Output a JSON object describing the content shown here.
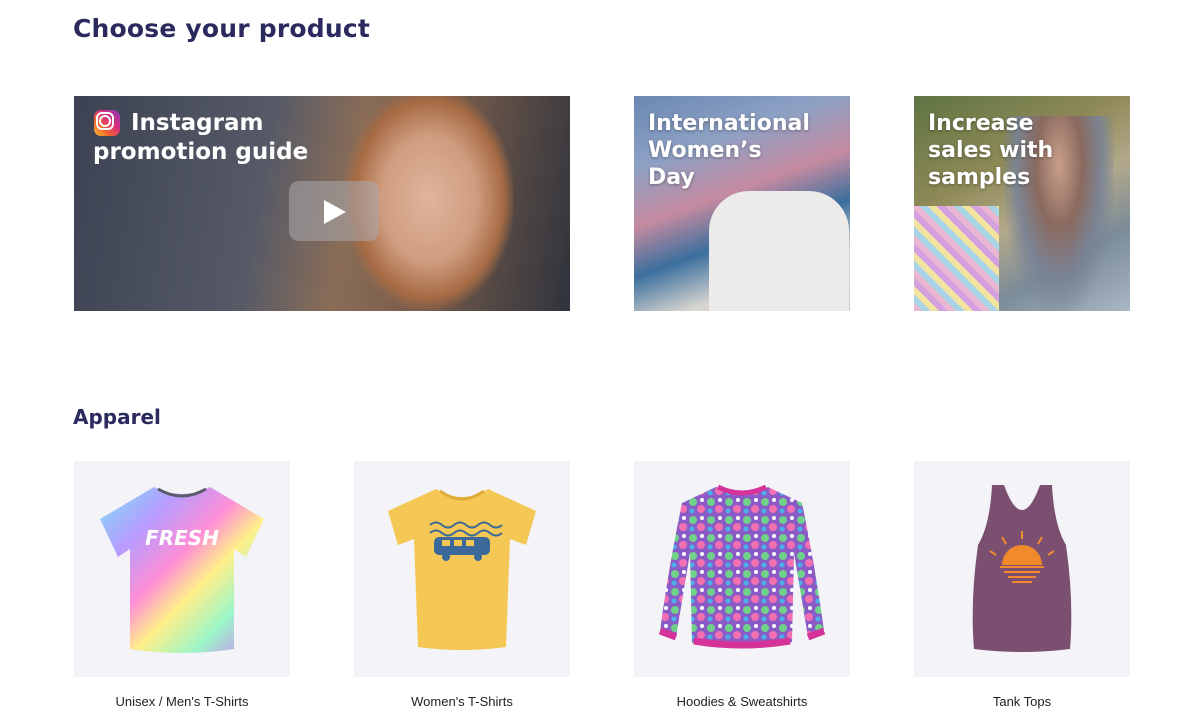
{
  "page": {
    "title": "Choose your product"
  },
  "promos": {
    "video": {
      "line1": "Instagram",
      "line2": "promotion guide",
      "icon": "instagram-icon",
      "play_icon": "play-icon"
    },
    "womens_day": {
      "text": "International\nWomen’s\nDay"
    },
    "samples": {
      "text": "Increase\nsales with\nsamples"
    }
  },
  "apparel": {
    "title": "Apparel",
    "items": [
      {
        "label": "Unisex / Men's T-Shirts"
      },
      {
        "label": "Women's T-Shirts"
      },
      {
        "label": "Hoodies & Sweatshirts"
      },
      {
        "label": "Tank Tops"
      }
    ],
    "shirt_text": "FRESH"
  },
  "colors": {
    "heading": "#2a2a5e",
    "card_background": "#f4f3f8",
    "womens_tee": "#f5c755",
    "tank_top": "#7b4f6f",
    "hoodie_trim": "#d5329a"
  }
}
